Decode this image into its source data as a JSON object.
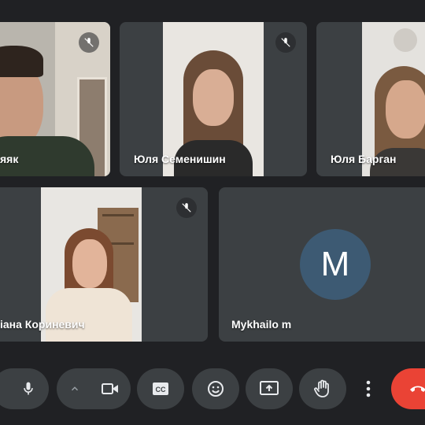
{
  "participants": [
    {
      "name": "яяк",
      "muted": true
    },
    {
      "name": "Юля Семенишин",
      "muted": true
    },
    {
      "name": "Юля Барган",
      "muted": false
    },
    {
      "name": "іана Кориневич",
      "muted": true
    },
    {
      "name": "Mykhailo m",
      "muted": false,
      "avatar_letter": "M",
      "avatar_color": "#3d5a73"
    }
  ],
  "controls": [
    {
      "id": "microphone",
      "icon": "mic-icon"
    },
    {
      "id": "audio-options",
      "icon": "chevron-up-icon"
    },
    {
      "id": "camera",
      "icon": "video-camera-icon"
    },
    {
      "id": "captions",
      "icon": "closed-captions-icon",
      "label": "CC"
    },
    {
      "id": "reactions",
      "icon": "emoji-icon"
    },
    {
      "id": "present",
      "icon": "present-screen-icon"
    },
    {
      "id": "raise-hand",
      "icon": "hand-icon"
    },
    {
      "id": "more",
      "icon": "more-vert-icon"
    },
    {
      "id": "leave-call",
      "icon": "phone-end-icon",
      "color": "#ea4335"
    }
  ],
  "theme": {
    "background": "#202124",
    "tile": "#3c4043",
    "end_call": "#ea4335"
  }
}
